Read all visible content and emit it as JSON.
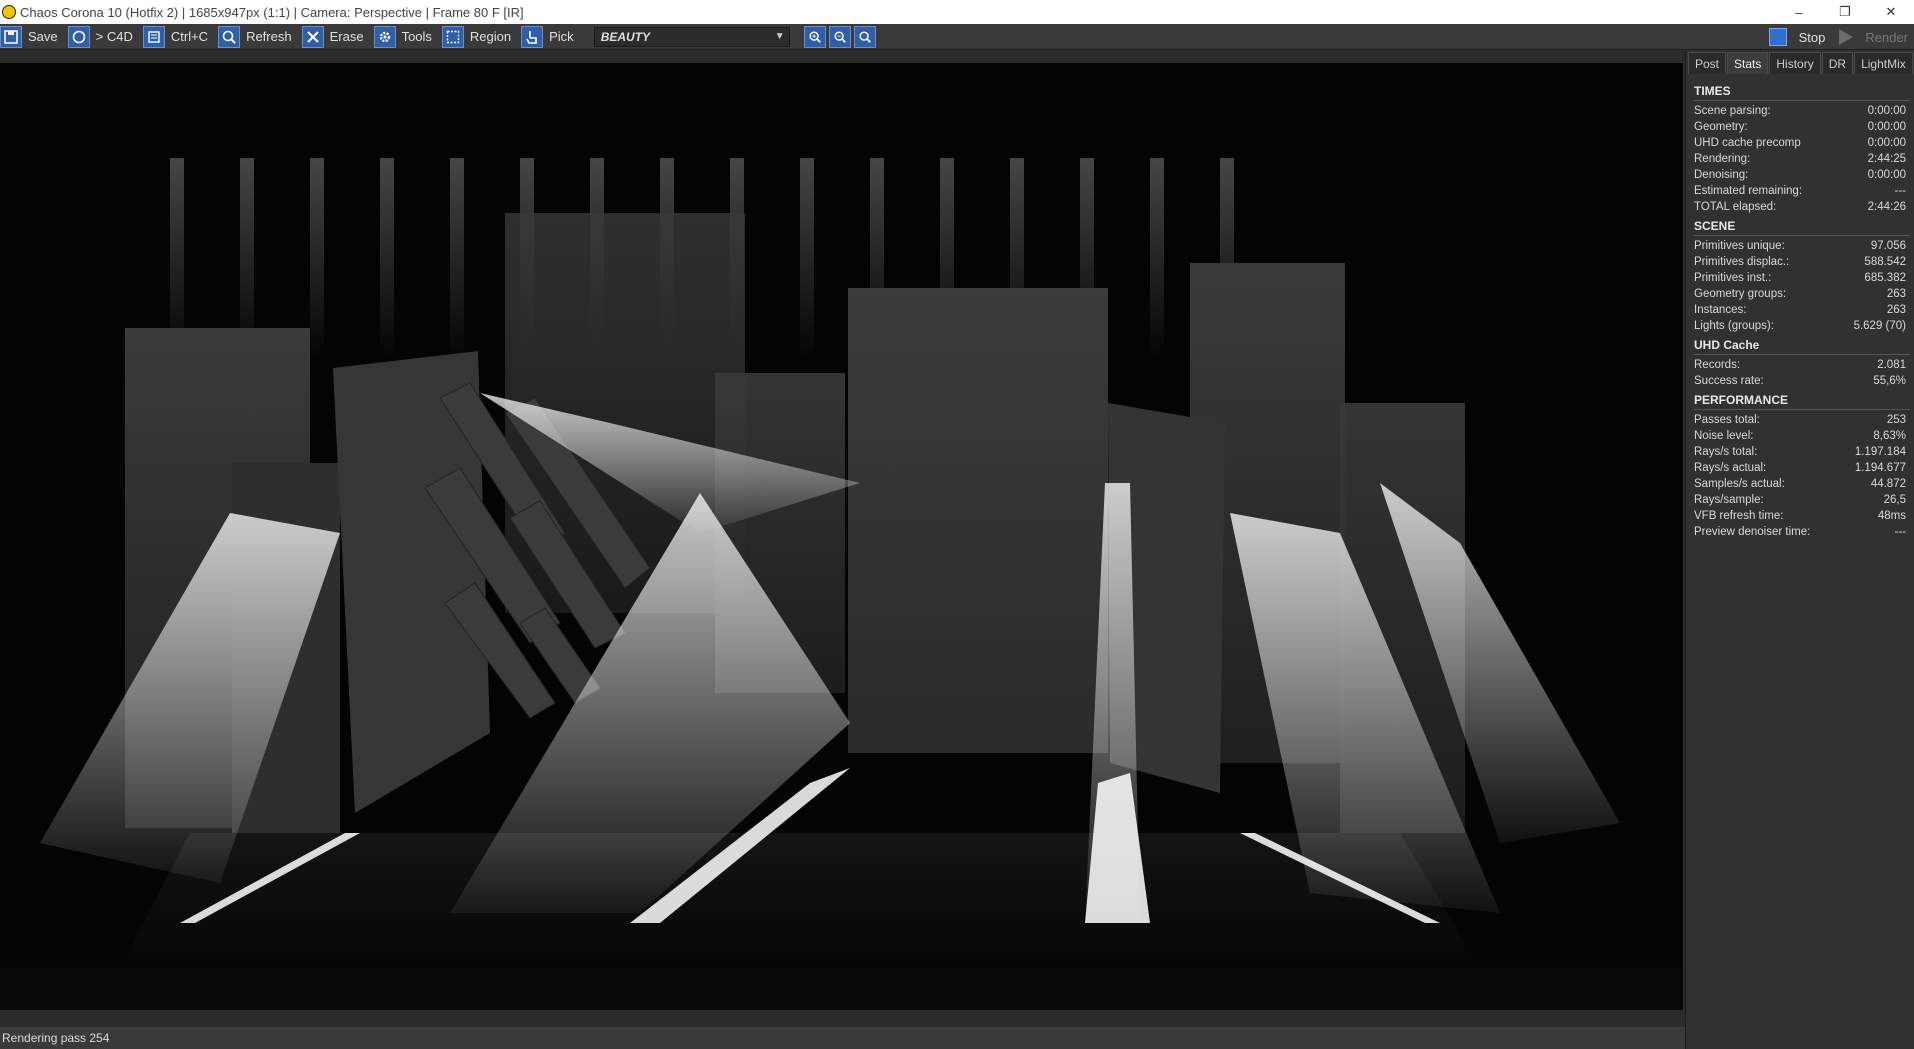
{
  "window": {
    "title": "Chaos Corona 10 (Hotfix 2) | 1685x947px (1:1) | Camera: Perspective | Frame 80 F [IR]",
    "minimize": "–",
    "restore": "❐",
    "close": "✕"
  },
  "toolbar": {
    "save": "Save",
    "c4d": "> C4D",
    "ctrlc": "Ctrl+C",
    "refresh": "Refresh",
    "erase": "Erase",
    "tools": "Tools",
    "region": "Region",
    "pick": "Pick",
    "pass": "BEAUTY",
    "stop": "Stop",
    "render": "Render"
  },
  "tabs": [
    {
      "label": "Post"
    },
    {
      "label": "Stats"
    },
    {
      "label": "History"
    },
    {
      "label": "DR"
    },
    {
      "label": "LightMix"
    }
  ],
  "stats": {
    "times": {
      "title": "TIMES",
      "rows": [
        {
          "label": "Scene parsing:",
          "value": "0:00:00"
        },
        {
          "label": "Geometry:",
          "value": "0:00:00"
        },
        {
          "label": "UHD cache precomp",
          "value": "0:00:00"
        },
        {
          "label": "Rendering:",
          "value": "2:44:25"
        },
        {
          "label": "Denoising:",
          "value": "0:00:00"
        },
        {
          "label": "Estimated remaining:",
          "value": "---"
        },
        {
          "label": "TOTAL elapsed:",
          "value": "2:44:26"
        }
      ]
    },
    "scene": {
      "title": "SCENE",
      "rows": [
        {
          "label": "Primitives unique:",
          "value": "97.056"
        },
        {
          "label": "Primitives displac.:",
          "value": "588.542"
        },
        {
          "label": "Primitives inst.:",
          "value": "685.382"
        },
        {
          "label": "Geometry groups:",
          "value": "263"
        },
        {
          "label": "Instances:",
          "value": "263"
        },
        {
          "label": "Lights (groups):",
          "value": "5.629 (70)"
        }
      ]
    },
    "uhd": {
      "title": "UHD Cache",
      "rows": [
        {
          "label": "Records:",
          "value": "2.081"
        },
        {
          "label": "Success rate:",
          "value": "55,6%"
        }
      ]
    },
    "performance": {
      "title": "PERFORMANCE",
      "rows": [
        {
          "label": "Passes total:",
          "value": "253"
        },
        {
          "label": "Noise level:",
          "value": "8,63%"
        },
        {
          "label": "Rays/s total:",
          "value": "1.197.184"
        },
        {
          "label": "Rays/s actual:",
          "value": "1.194.677"
        },
        {
          "label": "Samples/s actual:",
          "value": "44.872"
        },
        {
          "label": "Rays/sample:",
          "value": "26,5"
        },
        {
          "label": "VFB refresh time:",
          "value": "48ms"
        },
        {
          "label": "Preview denoiser time:",
          "value": "---"
        }
      ]
    }
  },
  "status": "Rendering pass 254",
  "colors": {
    "accent": "#2f5fa8",
    "panel": "#313131",
    "toolbar": "#3a3a3a"
  }
}
